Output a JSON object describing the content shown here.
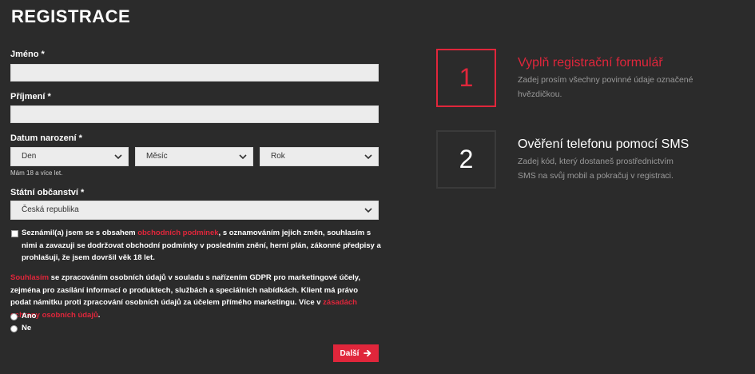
{
  "page": {
    "title": "REGISTRACE"
  },
  "form": {
    "first_name_label": "Jméno *",
    "last_name_label": "Příjmení *",
    "birthdate_label": "Datum narození *",
    "day_select": "Den",
    "month_select": "Měsíc",
    "year_select": "Rok",
    "age_hint": "Mám 18 a více let.",
    "citizenship_label": "Státní občanství *",
    "citizenship_select": "Česká republika",
    "terms": {
      "part1": "Seznámil(a) jsem se s obsahem ",
      "link": "obchodních podmínek",
      "part2": ", s oznamováním jejich změn, souhlasím s nimi a zavazuji se dodržovat obchodní podmínky v posledním znění, herní plán, zákonné předpisy a prohlašuji, že jsem dovršil věk 18 let."
    },
    "gdpr": {
      "link1": "Souhlasím",
      "part1": " se zpracováním osobních údajů v souladu s nařízením GDPR pro marketingové účely, zejména pro zasílání informací o produktech, službách a speciálních nabídkách. Klient má právo podat námitku proti zpracování osobních údajů za účelem přímého marketingu. Více v ",
      "link2": "zásadách ochrany osobních údajů",
      "part2": "."
    },
    "radio_yes": "Ano",
    "radio_no": "Ne",
    "next_button": "Další"
  },
  "steps": [
    {
      "number": "1",
      "title": "Vyplň registrační formulář",
      "description": "Zadej prosím všechny povinné údaje označené hvězdičkou."
    },
    {
      "number": "2",
      "title": "Ověření telefonu pomocí SMS",
      "description": "Zadej kód, který dostaneš prostřednictvím SMS na svůj mobil a pokračuj v registraci."
    }
  ],
  "colors": {
    "background": "#2b2b2b",
    "accent": "#e0263b",
    "input_bg": "#ececec",
    "muted_text": "#9a9a9a"
  }
}
